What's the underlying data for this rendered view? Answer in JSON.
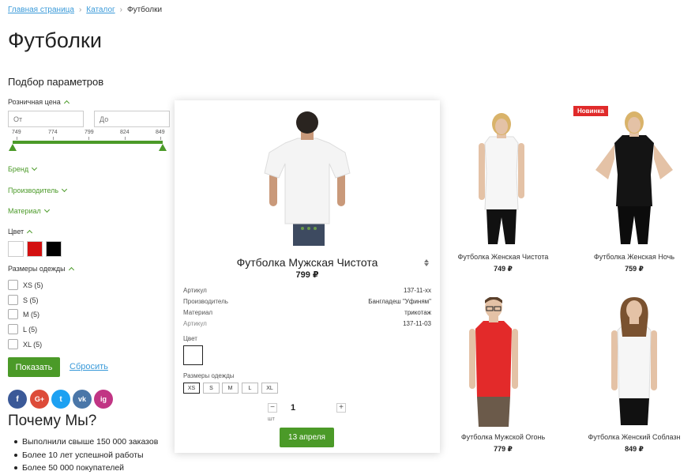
{
  "breadcrumb": {
    "home": "Главная страница",
    "catalog": "Каталог",
    "current": "Футболки"
  },
  "page_title": "Футболки",
  "filter": {
    "title": "Подбор параметров",
    "price": {
      "label": "Розничная цена",
      "from_placeholder": "От",
      "to_placeholder": "До",
      "scale": [
        "749",
        "774",
        "799",
        "824",
        "849"
      ]
    },
    "brand_label": "Бренд",
    "manufacturer_label": "Производитель",
    "material_label": "Материал",
    "color_label": "Цвет",
    "colors": [
      "#ffffff",
      "#d31010",
      "#000000"
    ],
    "sizes_label": "Размеры одежды",
    "sizes": [
      {
        "label": "XS (5)"
      },
      {
        "label": "S (5)"
      },
      {
        "label": "M (5)"
      },
      {
        "label": "L (5)"
      },
      {
        "label": "XL (5)"
      }
    ],
    "show_button": "Показать",
    "reset_link": "Сбросить"
  },
  "social": [
    "f",
    "G+",
    "t",
    "vk",
    "ig"
  ],
  "why": {
    "title": "Почему Мы?",
    "items": [
      "Выполнили свыше 150 000 заказов",
      "Более 10 лет успешной работы",
      "Более 50 000 покупателей"
    ]
  },
  "quick_view": {
    "title": "Футболка Мужская Чистота",
    "price": "799 ₽",
    "props": [
      {
        "name": "Артикул",
        "value": "137-11-xx"
      },
      {
        "name": "Производитель",
        "value": "Бангладеш \"Уфиням\""
      },
      {
        "name": "Материал",
        "value": "трикотаж"
      },
      {
        "name": "Артикул",
        "value": "137-11-03"
      }
    ],
    "color_label": "Цвет",
    "sizes_label": "Размеры одежды",
    "sizes": [
      "XS",
      "S",
      "M",
      "L",
      "XL"
    ],
    "selected_size": "XS",
    "qty": "1",
    "qty_unit": "шт",
    "minus": "−",
    "plus": "+",
    "buy_button": "13 апреля"
  },
  "products": [
    {
      "name": "Футболка Женская Чистота",
      "price": "749 ₽"
    },
    {
      "name": "Футболка Женская Ночь",
      "price": "759 ₽",
      "badge": "Новинка"
    },
    {
      "name": "Футболка Мужской Огонь",
      "price": "779 ₽"
    },
    {
      "name": "Футболка Женский Соблазн",
      "price": "849 ₽"
    }
  ],
  "colors": {
    "accent": "#4b9a28",
    "link": "#3a9ad9",
    "badge": "#e02a2a"
  }
}
